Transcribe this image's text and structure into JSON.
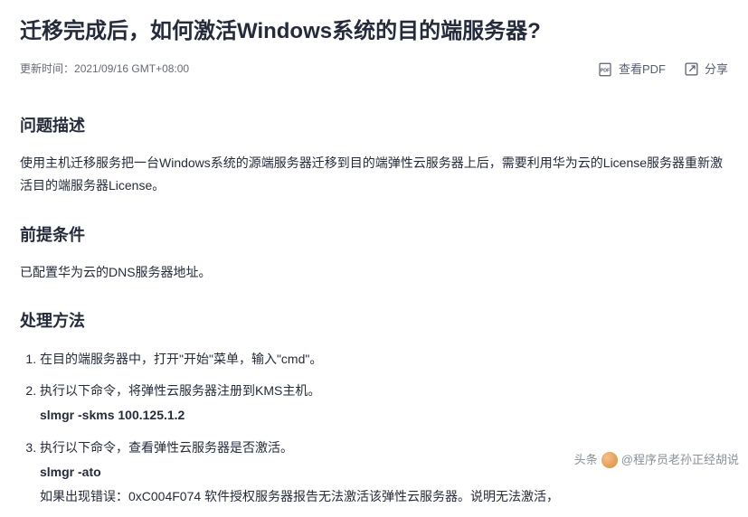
{
  "title": "迁移完成后，如何激活Windows系统的目的端服务器?",
  "meta": {
    "updateLabel": "更新时间：",
    "updateTime": "2021/09/16 GMT+08:00",
    "viewPdf": "查看PDF",
    "share": "分享"
  },
  "sections": {
    "problem": {
      "heading": "问题描述",
      "body": "使用主机迁移服务把一台Windows系统的源端服务器迁移到目的端弹性云服务器上后，需要利用华为云的License服务器重新激活目的端服务器License。"
    },
    "prereq": {
      "heading": "前提条件",
      "body": "已配置华为云的DNS服务器地址。"
    },
    "method": {
      "heading": "处理方法",
      "steps": [
        {
          "text": "在目的端服务器中，打开\"开始\"菜单，输入\"cmd\"。",
          "cmd": "",
          "note": ""
        },
        {
          "text": "执行以下命令，将弹性云服务器注册到KMS主机。",
          "cmd": "slmgr -skms 100.125.1.2",
          "note": ""
        },
        {
          "text": "执行以下命令，查看弹性云服务器是否激活。",
          "cmd": "slmgr -ato",
          "note": "如果出现错误：0xC004F074 软件授权服务器报告无法激活该弹性云服务器。说明无法激活，"
        }
      ]
    }
  },
  "watermark": {
    "prefix": "头条",
    "handle": "@程序员老孙正经胡说"
  }
}
